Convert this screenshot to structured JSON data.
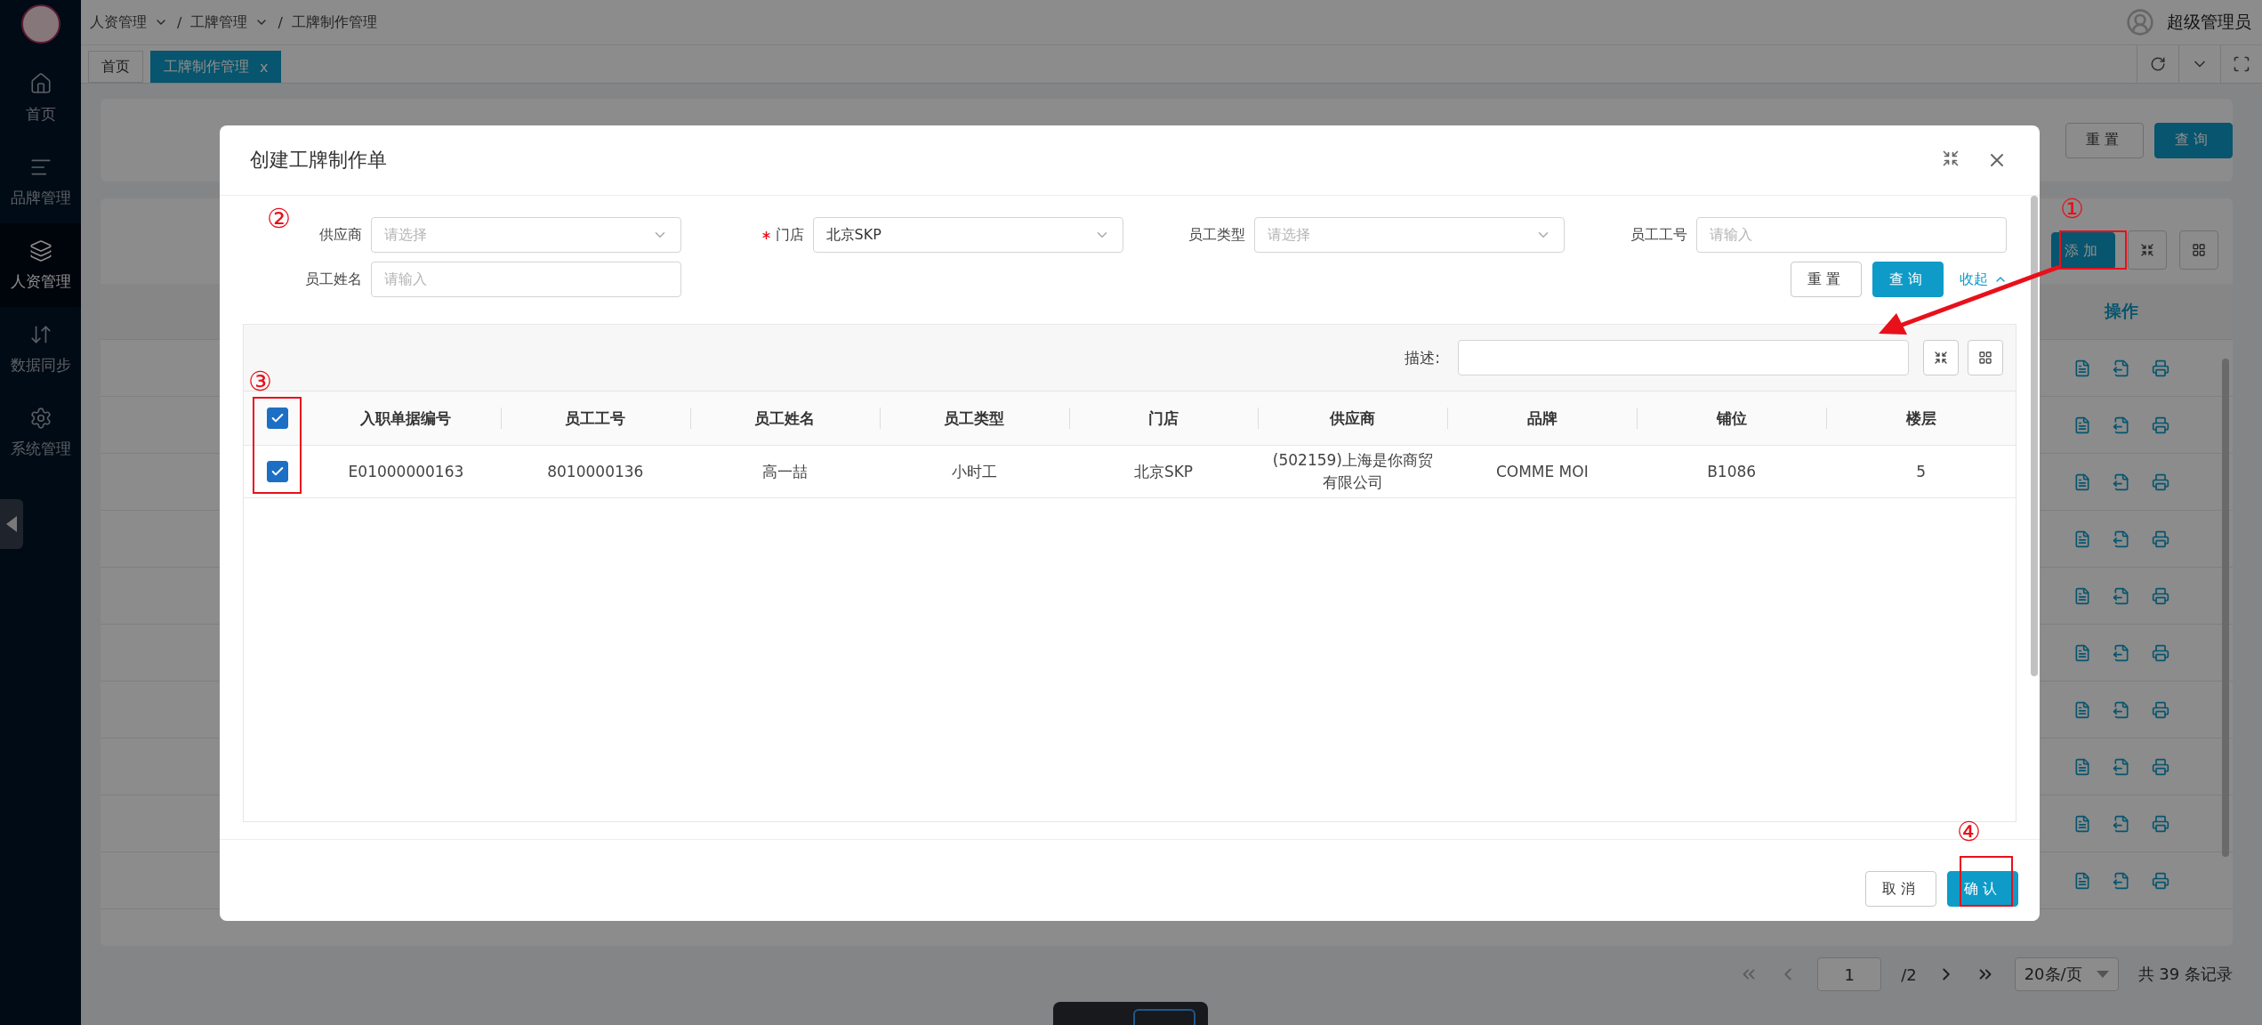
{
  "sidebar": {
    "items": [
      {
        "label": "首页",
        "selected": false
      },
      {
        "label": "品牌管理",
        "selected": false
      },
      {
        "label": "人资管理",
        "selected": true
      },
      {
        "label": "数据同步",
        "selected": false
      },
      {
        "label": "系统管理",
        "selected": false
      }
    ]
  },
  "breadcrumb": [
    {
      "label": "人资管理",
      "dropdown": true
    },
    {
      "label": "工牌管理",
      "dropdown": true
    },
    {
      "label": "工牌制作管理",
      "dropdown": false
    }
  ],
  "breadcrumb_separator": "/",
  "user": {
    "name": "超级管理员"
  },
  "tabs": [
    {
      "label": "首页",
      "selected": false,
      "closable": false
    },
    {
      "label": "工牌制作管理",
      "selected": true,
      "closable": true
    }
  ],
  "tab_close": "x",
  "query_card": {
    "buttons": [
      {
        "label": "重置",
        "primary": false
      },
      {
        "label": "查询",
        "primary": true
      }
    ]
  },
  "list": {
    "add_button": "添加",
    "actions_header": "操作",
    "rows": [
      {
        "kind": "record"
      },
      {
        "kind": "record"
      },
      {
        "kind": "record"
      },
      {
        "kind": "record"
      },
      {
        "kind": "record"
      },
      {
        "kind": "record"
      },
      {
        "kind": "record"
      },
      {
        "kind": "record"
      },
      {
        "kind": "record"
      },
      {
        "kind": "record"
      }
    ]
  },
  "pagination": {
    "page": "1",
    "total_pages": "/2",
    "page_size": "20条/页",
    "total": "共 39 条记录"
  },
  "modal": {
    "title": "创建工牌制作单",
    "filters": [
      {
        "label": "供应商",
        "kind": "select",
        "placeholder": "请选择",
        "required": false
      },
      {
        "label": "门店",
        "kind": "select",
        "value": "北京SKP",
        "required": true
      },
      {
        "label": "员工类型",
        "kind": "select",
        "placeholder": "请选择",
        "required": false
      },
      {
        "label": "员工工号",
        "kind": "input",
        "placeholder": "请输入",
        "required": false
      },
      {
        "label": "员工姓名",
        "kind": "input",
        "placeholder": "请输入",
        "required": false
      }
    ],
    "filter_buttons": {
      "reset": "重置",
      "search": "查询",
      "collapse": "收起"
    },
    "description_label": "描述:",
    "table": {
      "all_checked": true,
      "columns": [
        "入职单据编号",
        "员工工号",
        "员工姓名",
        "员工类型",
        "门店",
        "供应商",
        "品牌",
        "铺位",
        "楼层"
      ],
      "rows": [
        {
          "selected": true,
          "cells": [
            "E01000000163",
            "8010000136",
            "高一喆",
            "小时工",
            "北京SKP",
            "(502159)上海是你商贸有限公司",
            "COMME MOI",
            "B1086",
            "5"
          ]
        }
      ]
    },
    "footer_buttons": [
      {
        "label": "取消",
        "primary": false
      },
      {
        "label": "确认",
        "primary": true
      }
    ]
  },
  "annotations": [
    {
      "label": "①"
    },
    {
      "label": "②"
    },
    {
      "label": "③"
    },
    {
      "label": "④"
    }
  ]
}
